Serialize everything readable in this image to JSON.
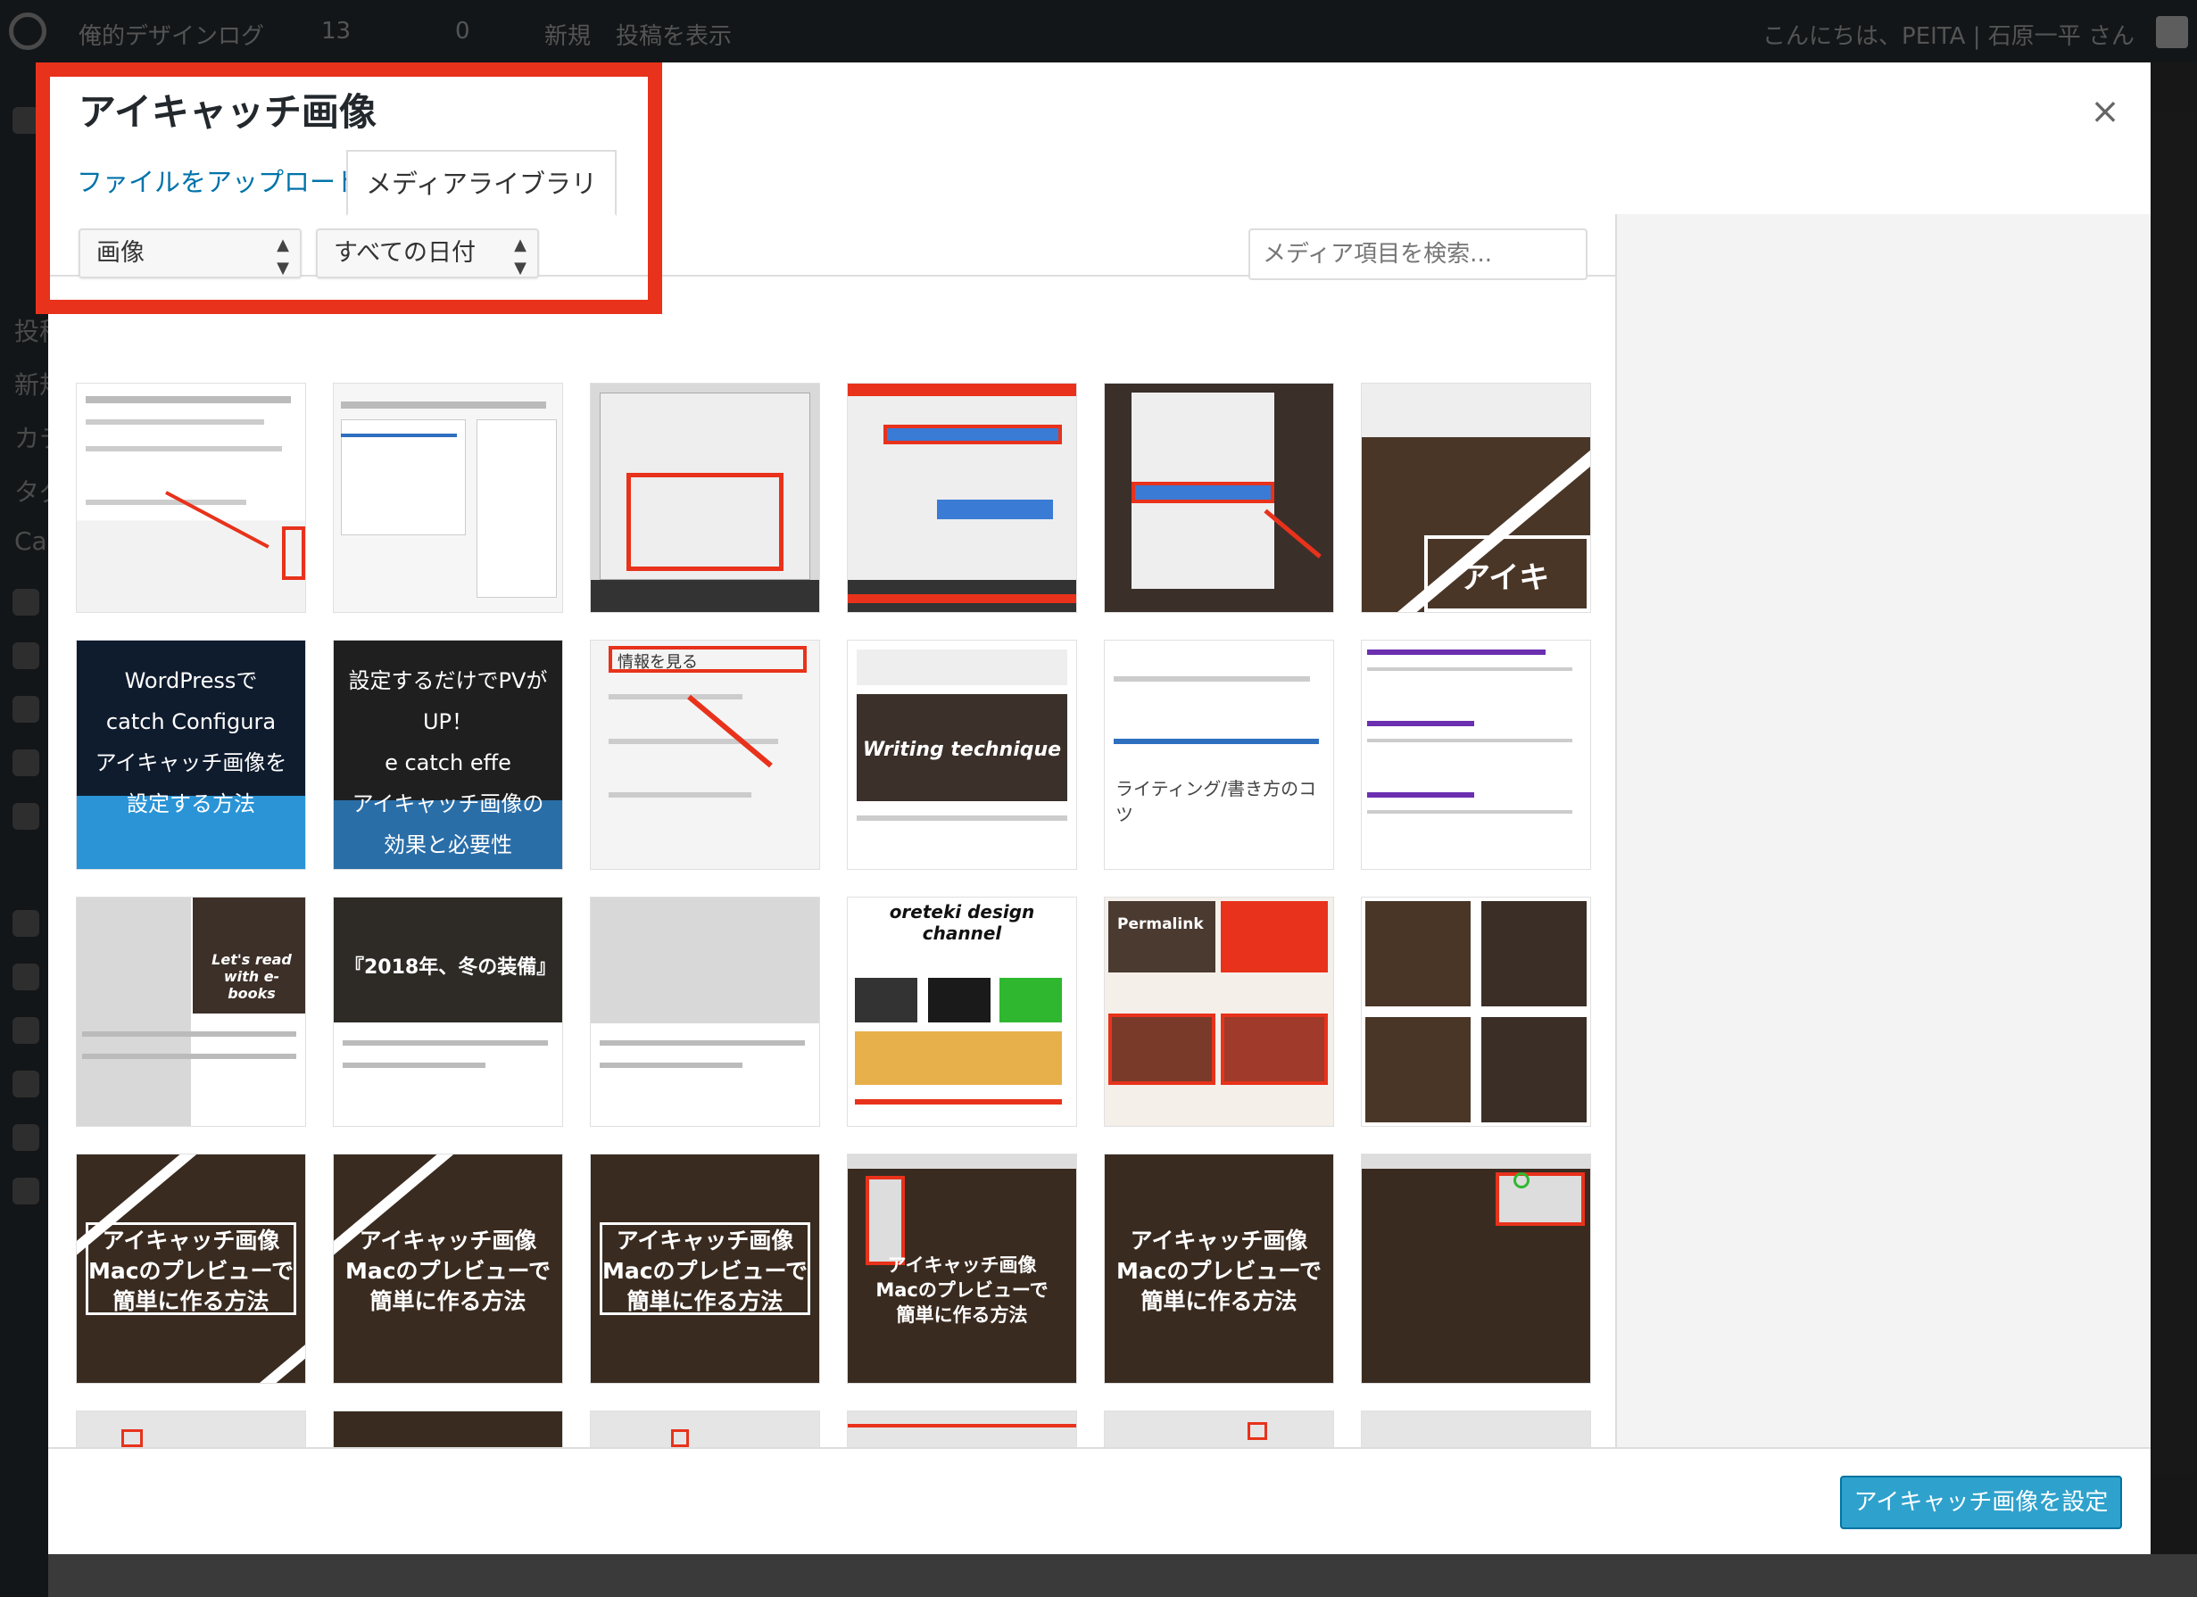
{
  "adminbar": {
    "site_name": "俺的デザインログ",
    "update_count": "13",
    "comment_count": "0",
    "new_label": "新規",
    "view_posts_label": "投稿を表示",
    "greeting": "こんにちは、PEITA | 石原一平 さん"
  },
  "admin_sidebar_text": [
    "投稿",
    "新規",
    "カテ",
    "タグ",
    "Ca"
  ],
  "modal": {
    "title": "アイキャッチ画像",
    "close_symbol": "×",
    "tabs": {
      "upload": "ファイルをアップロード",
      "library": "メディアライブラリ"
    },
    "filter_type": "画像",
    "filter_date": "すべての日付",
    "search_placeholder": "メディア項目を検索...",
    "set_button": "アイキャッチ画像を設定"
  },
  "thumbnails_row1": [
    "",
    "",
    "",
    "",
    "",
    "アイキ"
  ],
  "thumbnails_row2": [
    "WordPressで\ncatch Configura\nアイキャッチ画像を設定する方法",
    "設定するだけでPVがUP！\ne catch effe\nアイキャッチ画像の効果と必要性",
    "情報を見る",
    "Writing technique",
    "ライティング/書き方のコツ",
    ""
  ],
  "thumbnails_row3": [
    "Let's read\nwith e-books",
    "『2018年、冬の装備』",
    "",
    "oreteki design channel",
    "Permalink",
    ""
  ],
  "thumbnails_row4": [
    "アイキャッチ画像\nMacのプレビューで\n簡単に作る方法",
    "アイキャッチ画像\nMacのプレビューで\n簡単に作る方法",
    "アイキャッチ画像\nMacのプレビューで\n簡単に作る方法",
    "アイキャッチ画像\nMacのプレビューで\n簡単に作る方法",
    "アイキャッチ画像\nMacのプレビューで\n簡単に作る方法",
    ""
  ],
  "thumbnails_row5": [
    "",
    "",
    "",
    "",
    "",
    ""
  ],
  "colors": {
    "accent": "#0073aa",
    "button": "#2ea2cc",
    "highlight": "#e8321b"
  }
}
